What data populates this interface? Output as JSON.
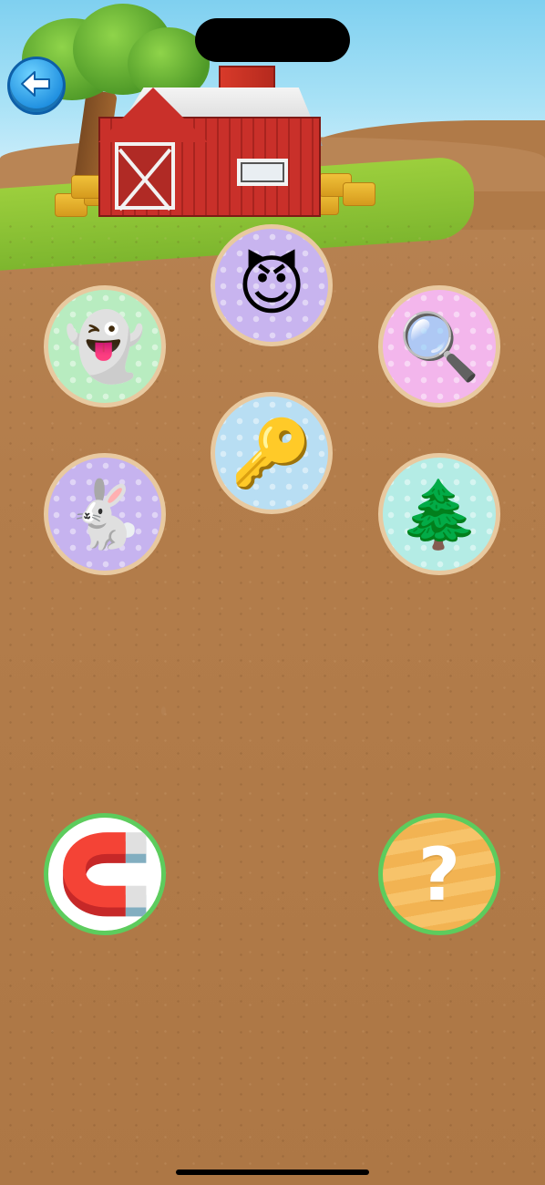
{
  "header": {
    "back_button_label": "",
    "back_icon": "left-arrow-icon"
  },
  "scene": {
    "background": "farm-with-red-barn",
    "sky_color": "#a9e2f6",
    "dirt_color": "#b37d4b",
    "barn_color": "#c9302a"
  },
  "tokens": [
    {
      "name": "smiling-devil",
      "emoji": "😈",
      "bg": "#c8b4ef"
    },
    {
      "name": "ghost",
      "emoji": "👻",
      "bg": "#b8ecc0"
    },
    {
      "name": "magnifying-glass",
      "emoji": "🔍",
      "bg": "#f3b6ec"
    },
    {
      "name": "key",
      "emoji": "🔑",
      "bg": "#b8def3"
    },
    {
      "name": "rabbit",
      "emoji": "🐇",
      "bg": "#c6b3ef"
    },
    {
      "name": "evergreen-tree",
      "emoji": "🌲",
      "bg": "#b4ece5"
    }
  ],
  "powerups": [
    {
      "name": "magnet",
      "emoji": "🧲",
      "bg": "#ffffff"
    },
    {
      "name": "hint",
      "symbol": "?",
      "bg": "#f7c36a"
    }
  ]
}
